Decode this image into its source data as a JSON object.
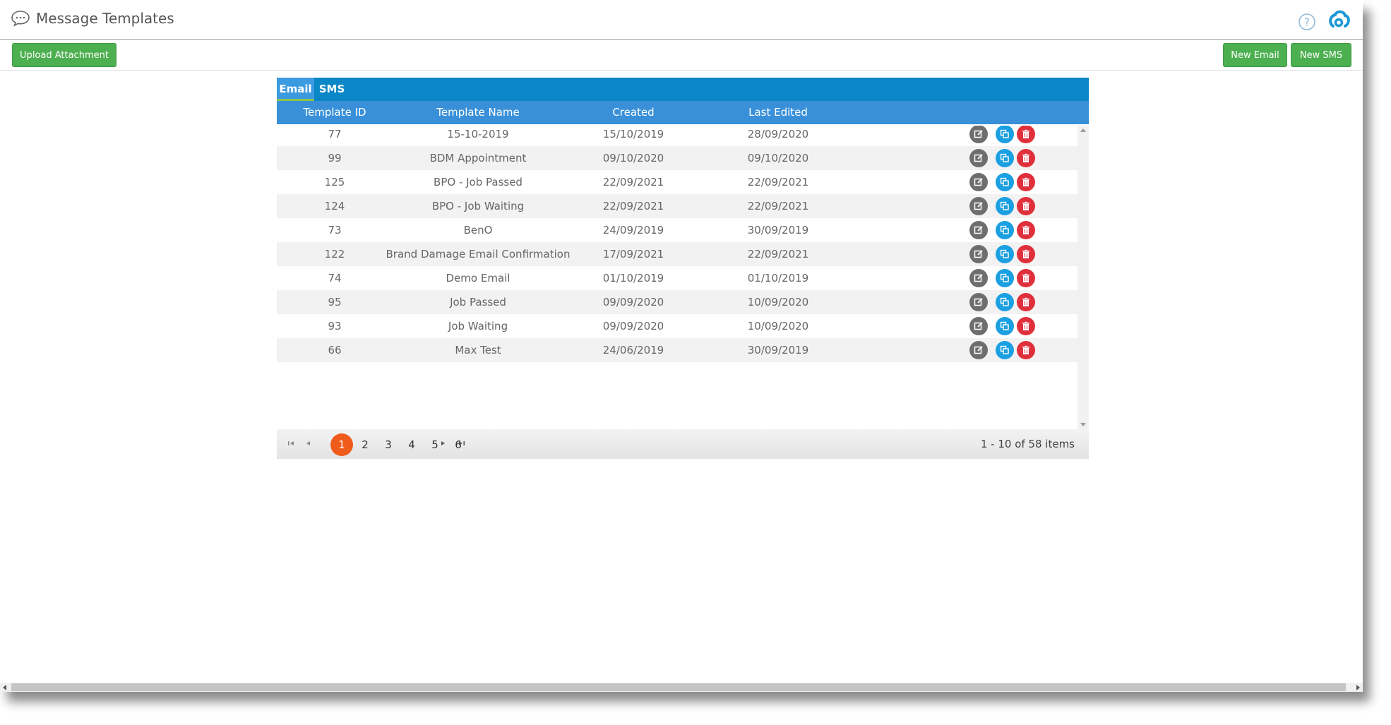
{
  "window": {
    "title": "Message Templates",
    "title_icon": "chat-bubble-icon",
    "help_icon": "help-icon",
    "logo_icon": "app-logo-icon"
  },
  "toolbar": {
    "upload_label": "Upload Attachment",
    "new_email_label": "New Email",
    "new_sms_label": "New SMS",
    "button_color": "#4caf50"
  },
  "tabs": [
    {
      "label": "Email",
      "active": true
    },
    {
      "label": "SMS",
      "active": false
    }
  ],
  "columns": [
    "Template ID",
    "Template Name",
    "Created",
    "Last Edited"
  ],
  "rows": [
    {
      "id": "77",
      "name": "15-10-2019",
      "created": "15/10/2019",
      "edited": "28/09/2020"
    },
    {
      "id": "99",
      "name": "BDM Appointment",
      "created": "09/10/2020",
      "edited": "09/10/2020"
    },
    {
      "id": "125",
      "name": "BPO - Job Passed",
      "created": "22/09/2021",
      "edited": "22/09/2021"
    },
    {
      "id": "124",
      "name": "BPO - Job Waiting",
      "created": "22/09/2021",
      "edited": "22/09/2021"
    },
    {
      "id": "73",
      "name": "BenO",
      "created": "24/09/2019",
      "edited": "30/09/2019"
    },
    {
      "id": "122",
      "name": "Brand Damage Email Confirmation",
      "created": "17/09/2021",
      "edited": "22/09/2021"
    },
    {
      "id": "74",
      "name": "Demo Email",
      "created": "01/10/2019",
      "edited": "01/10/2019"
    },
    {
      "id": "95",
      "name": "Job Passed",
      "created": "09/09/2020",
      "edited": "10/09/2020"
    },
    {
      "id": "93",
      "name": "Job Waiting",
      "created": "09/09/2020",
      "edited": "10/09/2020"
    },
    {
      "id": "66",
      "name": "Max Test",
      "created": "24/06/2019",
      "edited": "30/09/2019"
    }
  ],
  "row_actions": [
    {
      "icon": "edit-icon",
      "color": "#6e6e6e"
    },
    {
      "icon": "copy-icon",
      "color": "#1aa0e0"
    },
    {
      "icon": "trash-icon",
      "color": "#e0303b"
    }
  ],
  "pager": {
    "pages": [
      "1",
      "2",
      "3",
      "4",
      "5",
      "6"
    ],
    "current": "1",
    "info": "1 - 10 of 58 items",
    "active_color": "#ef5b1a"
  },
  "colors": {
    "tab_bar": "#0b86c6",
    "header_row": "#3a90d8",
    "tab_underline": "#8bc34a"
  }
}
